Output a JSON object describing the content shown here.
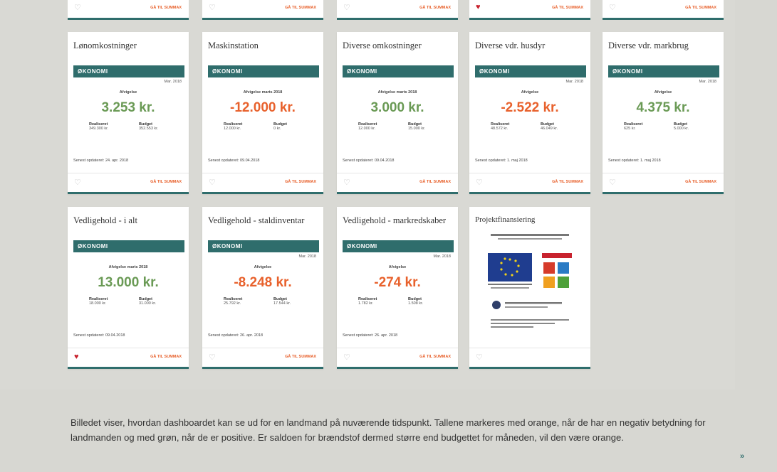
{
  "top_strip": [
    {
      "link": "GÅ TIL SUMMAX",
      "favorite": false
    },
    {
      "link": "GÅ TIL SUMMAX",
      "favorite": false
    },
    {
      "link": "GÅ TIL SUMMAX",
      "favorite": false
    },
    {
      "link": "GÅ TIL SUMMAX",
      "favorite": true
    },
    {
      "link": "GÅ TIL SUMMAX",
      "favorite": false
    }
  ],
  "cards": [
    {
      "title": "Lønomkostninger",
      "bar": "ØKONOMI",
      "date": "Mar. 2018",
      "caption": "Afvigelse",
      "amount": "3.253 kr.",
      "tone": "positive",
      "realized_label": "Realiseret",
      "realized": "349.300 kr.",
      "budget_label": "Budget",
      "budget": "352.553 kr.",
      "updated": "Senest opdateret: 24. apr. 2018",
      "link": "GÅ TIL SUMMAX",
      "favorite": false
    },
    {
      "title": "Maskinstation",
      "bar": "ØKONOMI",
      "date": "",
      "caption": "Afvigelse marts 2018",
      "amount": "-12.000 kr.",
      "tone": "negative",
      "realized_label": "Realiseret",
      "realized": "12.000 kr.",
      "budget_label": "Budget",
      "budget": "0 kr.",
      "updated": "Senest opdateret: 09.04.2018",
      "link": "GÅ TIL SUMMAX",
      "favorite": false
    },
    {
      "title": "Diverse omkostninger",
      "bar": "ØKONOMI",
      "date": "",
      "caption": "Afvigelse marts 2018",
      "amount": "3.000 kr.",
      "tone": "positive",
      "realized_label": "Realiseret",
      "realized": "12.000 kr.",
      "budget_label": "Budget",
      "budget": "15.000 kr.",
      "updated": "Senest opdateret: 09.04.2018",
      "link": "GÅ TIL SUMMAX",
      "favorite": false
    },
    {
      "title": "Diverse vdr. husdyr",
      "bar": "ØKONOMI",
      "date": "Mar. 2018",
      "caption": "Afvigelse",
      "amount": "-2.522 kr.",
      "tone": "negative",
      "realized_label": "Realiseret",
      "realized": "48.572 kr.",
      "budget_label": "Budget",
      "budget": "46.049 kr.",
      "updated": "Senest opdateret: 1. maj 2018",
      "link": "GÅ TIL SUMMAX",
      "favorite": false
    },
    {
      "title": "Diverse vdr. markbrug",
      "bar": "ØKONOMI",
      "date": "Mar. 2018",
      "caption": "Afvigelse",
      "amount": "4.375 kr.",
      "tone": "positive",
      "realized_label": "Realiseret",
      "realized": "625 kr.",
      "budget_label": "Budget",
      "budget": "5.000 kr.",
      "updated": "Senest opdateret: 1. maj 2018",
      "link": "GÅ TIL SUMMAX",
      "favorite": false
    },
    {
      "title": "Vedligehold - i alt",
      "bar": "ØKONOMI",
      "date": "",
      "caption": "Afvigelse marts 2018",
      "amount": "13.000 kr.",
      "tone": "positive",
      "realized_label": "Realiseret",
      "realized": "18.000 kr.",
      "budget_label": "Budget",
      "budget": "31.000 kr.",
      "updated": "Senest opdateret: 09.04.2018",
      "link": "GÅ TIL SUMMAX",
      "favorite": true
    },
    {
      "title": "Vedligehold - staldinventar",
      "bar": "ØKONOMI",
      "date": "Mar. 2018",
      "caption": "Afvigelse",
      "amount": "-8.248 kr.",
      "tone": "negative",
      "realized_label": "Realiseret",
      "realized": "25.792 kr.",
      "budget_label": "Budget",
      "budget": "17.544 kr.",
      "updated": "Senest opdateret: 26. apr. 2018",
      "link": "GÅ TIL SUMMAX",
      "favorite": false
    },
    {
      "title": "Vedligehold - markredskaber",
      "bar": "ØKONOMI",
      "date": "Mar. 2018",
      "caption": "Afvigelse",
      "amount": "-274 kr.",
      "tone": "negative",
      "realized_label": "Realiseret",
      "realized": "1.782 kr.",
      "budget_label": "Budget",
      "budget": "1.508 kr.",
      "updated": "Senest opdateret: 26. apr. 2018",
      "link": "GÅ TIL SUMMAX",
      "favorite": false
    }
  ],
  "project_card": {
    "title": "Projektfinansiering",
    "eu_label": "EU",
    "ldp_label": "LDP 2020",
    "favorite": false
  },
  "caption": "Billedet viser, hvordan dashboardet kan se ud for en landmand på nuværende tidspunkt. Tallene markeres med orange, når de har en negativ betydning for landmanden og med grøn, når de er positive. Er saldoen for brændstof dermed større end budgettet for måneden, vil den være orange.",
  "next_label": "»",
  "colors": {
    "teal": "#2f6d6c",
    "orange": "#e8612c",
    "green": "#6a9a55",
    "heart": "#c8222e"
  }
}
